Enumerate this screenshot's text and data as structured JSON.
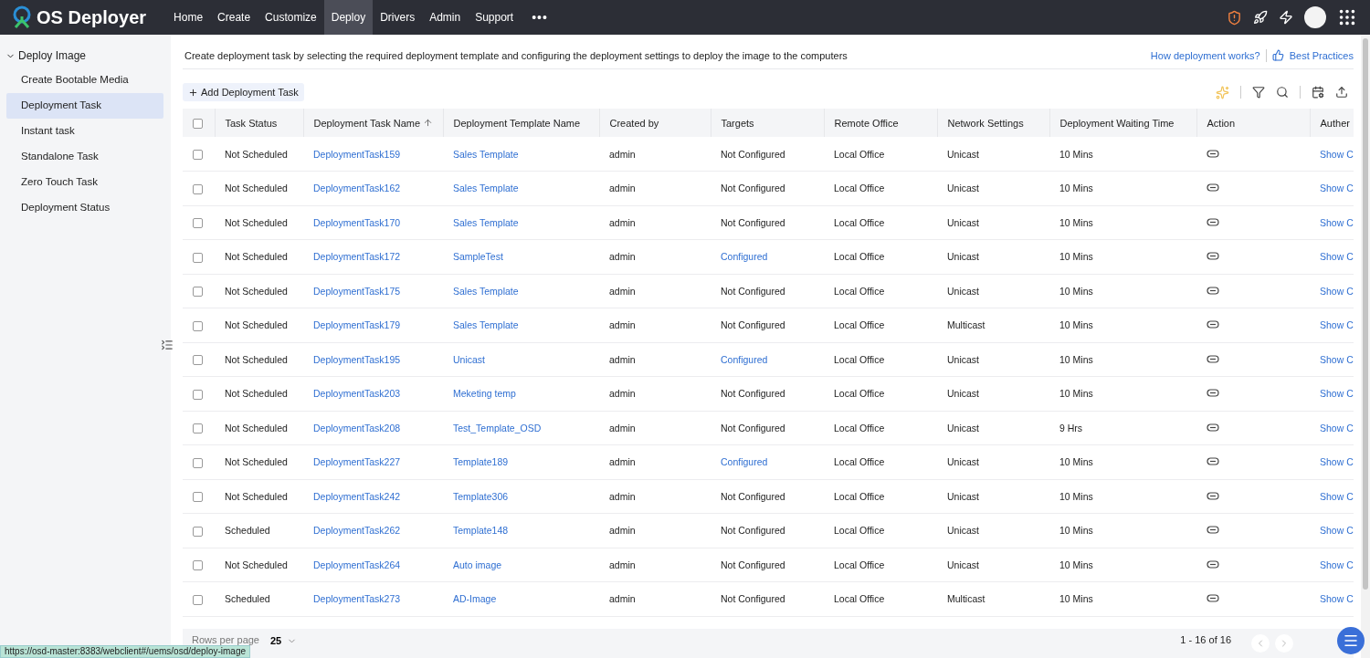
{
  "app": {
    "title": "OS Deployer"
  },
  "nav": [
    {
      "label": "Home",
      "selected": false
    },
    {
      "label": "Create",
      "selected": false
    },
    {
      "label": "Customize",
      "selected": false
    },
    {
      "label": "Deploy",
      "selected": true
    },
    {
      "label": "Drivers",
      "selected": false
    },
    {
      "label": "Admin",
      "selected": false
    },
    {
      "label": "Support",
      "selected": false
    }
  ],
  "nav_more": "•••",
  "sidebar": {
    "group": {
      "label": "Deploy Image",
      "expanded": true,
      "children": [
        {
          "label": "Create Bootable Media",
          "selected": false
        },
        {
          "label": "Deployment Task",
          "selected": true
        },
        {
          "label": "Instant task",
          "selected": false
        },
        {
          "label": "Standalone Task",
          "selected": false
        },
        {
          "label": "Zero Touch Task",
          "selected": false
        },
        {
          "label": "Deployment Status",
          "selected": false
        }
      ]
    }
  },
  "intro": {
    "text": "Create deployment task by selecting the required deployment template and configuring the deployment settings to deploy the image to the computers",
    "links": [
      "How deployment works?",
      "Best Practices"
    ]
  },
  "add_button": "Add Deployment Task",
  "table": {
    "select_all": {
      "checked": false
    },
    "columns": [
      {
        "label": "Task Status",
        "sorted": false
      },
      {
        "label": "Deployment Task Name",
        "sorted": true
      },
      {
        "label": "Deployment Template Name",
        "sorted": false
      },
      {
        "label": "Created by",
        "sorted": false
      },
      {
        "label": "Targets",
        "sorted": false
      },
      {
        "label": "Remote Office",
        "sorted": false
      },
      {
        "label": "Network Settings",
        "sorted": false
      },
      {
        "label": "Deployment Waiting Time",
        "sorted": false
      },
      {
        "label": "Action",
        "sorted": false
      },
      {
        "label": "Auther",
        "sorted": false
      }
    ],
    "rows": [
      {
        "selected": false,
        "status": "Not Scheduled",
        "name": "DeploymentTask159",
        "template": "Sales Template",
        "created_by": "admin",
        "targets": "Not Configured",
        "targets_link": false,
        "office": "Local Office",
        "network": "Unicast",
        "wait": "10 Mins",
        "auth": "Show C"
      },
      {
        "selected": false,
        "status": "Not Scheduled",
        "name": "DeploymentTask162",
        "template": "Sales Template",
        "created_by": "admin",
        "targets": "Not Configured",
        "targets_link": false,
        "office": "Local Office",
        "network": "Unicast",
        "wait": "10 Mins",
        "auth": "Show C"
      },
      {
        "selected": false,
        "status": "Not Scheduled",
        "name": "DeploymentTask170",
        "template": "Sales Template",
        "created_by": "admin",
        "targets": "Not Configured",
        "targets_link": false,
        "office": "Local Office",
        "network": "Unicast",
        "wait": "10 Mins",
        "auth": "Show C"
      },
      {
        "selected": false,
        "status": "Not Scheduled",
        "name": "DeploymentTask172",
        "template": "SampleTest",
        "created_by": "admin",
        "targets": "Configured",
        "targets_link": true,
        "office": "Local Office",
        "network": "Unicast",
        "wait": "10 Mins",
        "auth": "Show C"
      },
      {
        "selected": false,
        "status": "Not Scheduled",
        "name": "DeploymentTask175",
        "template": "Sales Template",
        "created_by": "admin",
        "targets": "Not Configured",
        "targets_link": false,
        "office": "Local Office",
        "network": "Unicast",
        "wait": "10 Mins",
        "auth": "Show C"
      },
      {
        "selected": false,
        "status": "Not Scheduled",
        "name": "DeploymentTask179",
        "template": "Sales Template",
        "created_by": "admin",
        "targets": "Not Configured",
        "targets_link": false,
        "office": "Local Office",
        "network": "Multicast",
        "wait": "10 Mins",
        "auth": "Show C"
      },
      {
        "selected": false,
        "status": "Not Scheduled",
        "name": "DeploymentTask195",
        "template": "Unicast",
        "created_by": "admin",
        "targets": "Configured",
        "targets_link": true,
        "office": "Local Office",
        "network": "Unicast",
        "wait": "10 Mins",
        "auth": "Show C"
      },
      {
        "selected": false,
        "status": "Not Scheduled",
        "name": "DeploymentTask203",
        "template": "Meketing temp",
        "created_by": "admin",
        "targets": "Not Configured",
        "targets_link": false,
        "office": "Local Office",
        "network": "Unicast",
        "wait": "10 Mins",
        "auth": "Show C"
      },
      {
        "selected": false,
        "status": "Not Scheduled",
        "name": "DeploymentTask208",
        "template": "Test_Template_OSD",
        "created_by": "admin",
        "targets": "Not Configured",
        "targets_link": false,
        "office": "Local Office",
        "network": "Unicast",
        "wait": "9 Hrs",
        "auth": "Show C"
      },
      {
        "selected": false,
        "status": "Not Scheduled",
        "name": "DeploymentTask227",
        "template": "Template189",
        "created_by": "admin",
        "targets": "Configured",
        "targets_link": true,
        "office": "Local Office",
        "network": "Unicast",
        "wait": "10 Mins",
        "auth": "Show C"
      },
      {
        "selected": false,
        "status": "Not Scheduled",
        "name": "DeploymentTask242",
        "template": "Template306",
        "created_by": "admin",
        "targets": "Not Configured",
        "targets_link": false,
        "office": "Local Office",
        "network": "Unicast",
        "wait": "10 Mins",
        "auth": "Show C"
      },
      {
        "selected": false,
        "status": "Scheduled",
        "name": "DeploymentTask262",
        "template": "Template148",
        "created_by": "admin",
        "targets": "Not Configured",
        "targets_link": false,
        "office": "Local Office",
        "network": "Unicast",
        "wait": "10 Mins",
        "auth": "Show C"
      },
      {
        "selected": false,
        "status": "Not Scheduled",
        "name": "DeploymentTask264",
        "template": "Auto image",
        "created_by": "admin",
        "targets": "Not Configured",
        "targets_link": false,
        "office": "Local Office",
        "network": "Unicast",
        "wait": "10 Mins",
        "auth": "Show C"
      },
      {
        "selected": false,
        "status": "Scheduled",
        "name": "DeploymentTask273",
        "template": "AD-Image",
        "created_by": "admin",
        "targets": "Not Configured",
        "targets_link": false,
        "office": "Local Office",
        "network": "Multicast",
        "wait": "10 Mins",
        "auth": "Show C"
      }
    ]
  },
  "footer": {
    "rows_label": "Rows per page",
    "rows_value": "25",
    "range": "1 - 16 of 16"
  },
  "status_url": "https://osd-master:8383/webclient#/uems/osd/deploy-image"
}
